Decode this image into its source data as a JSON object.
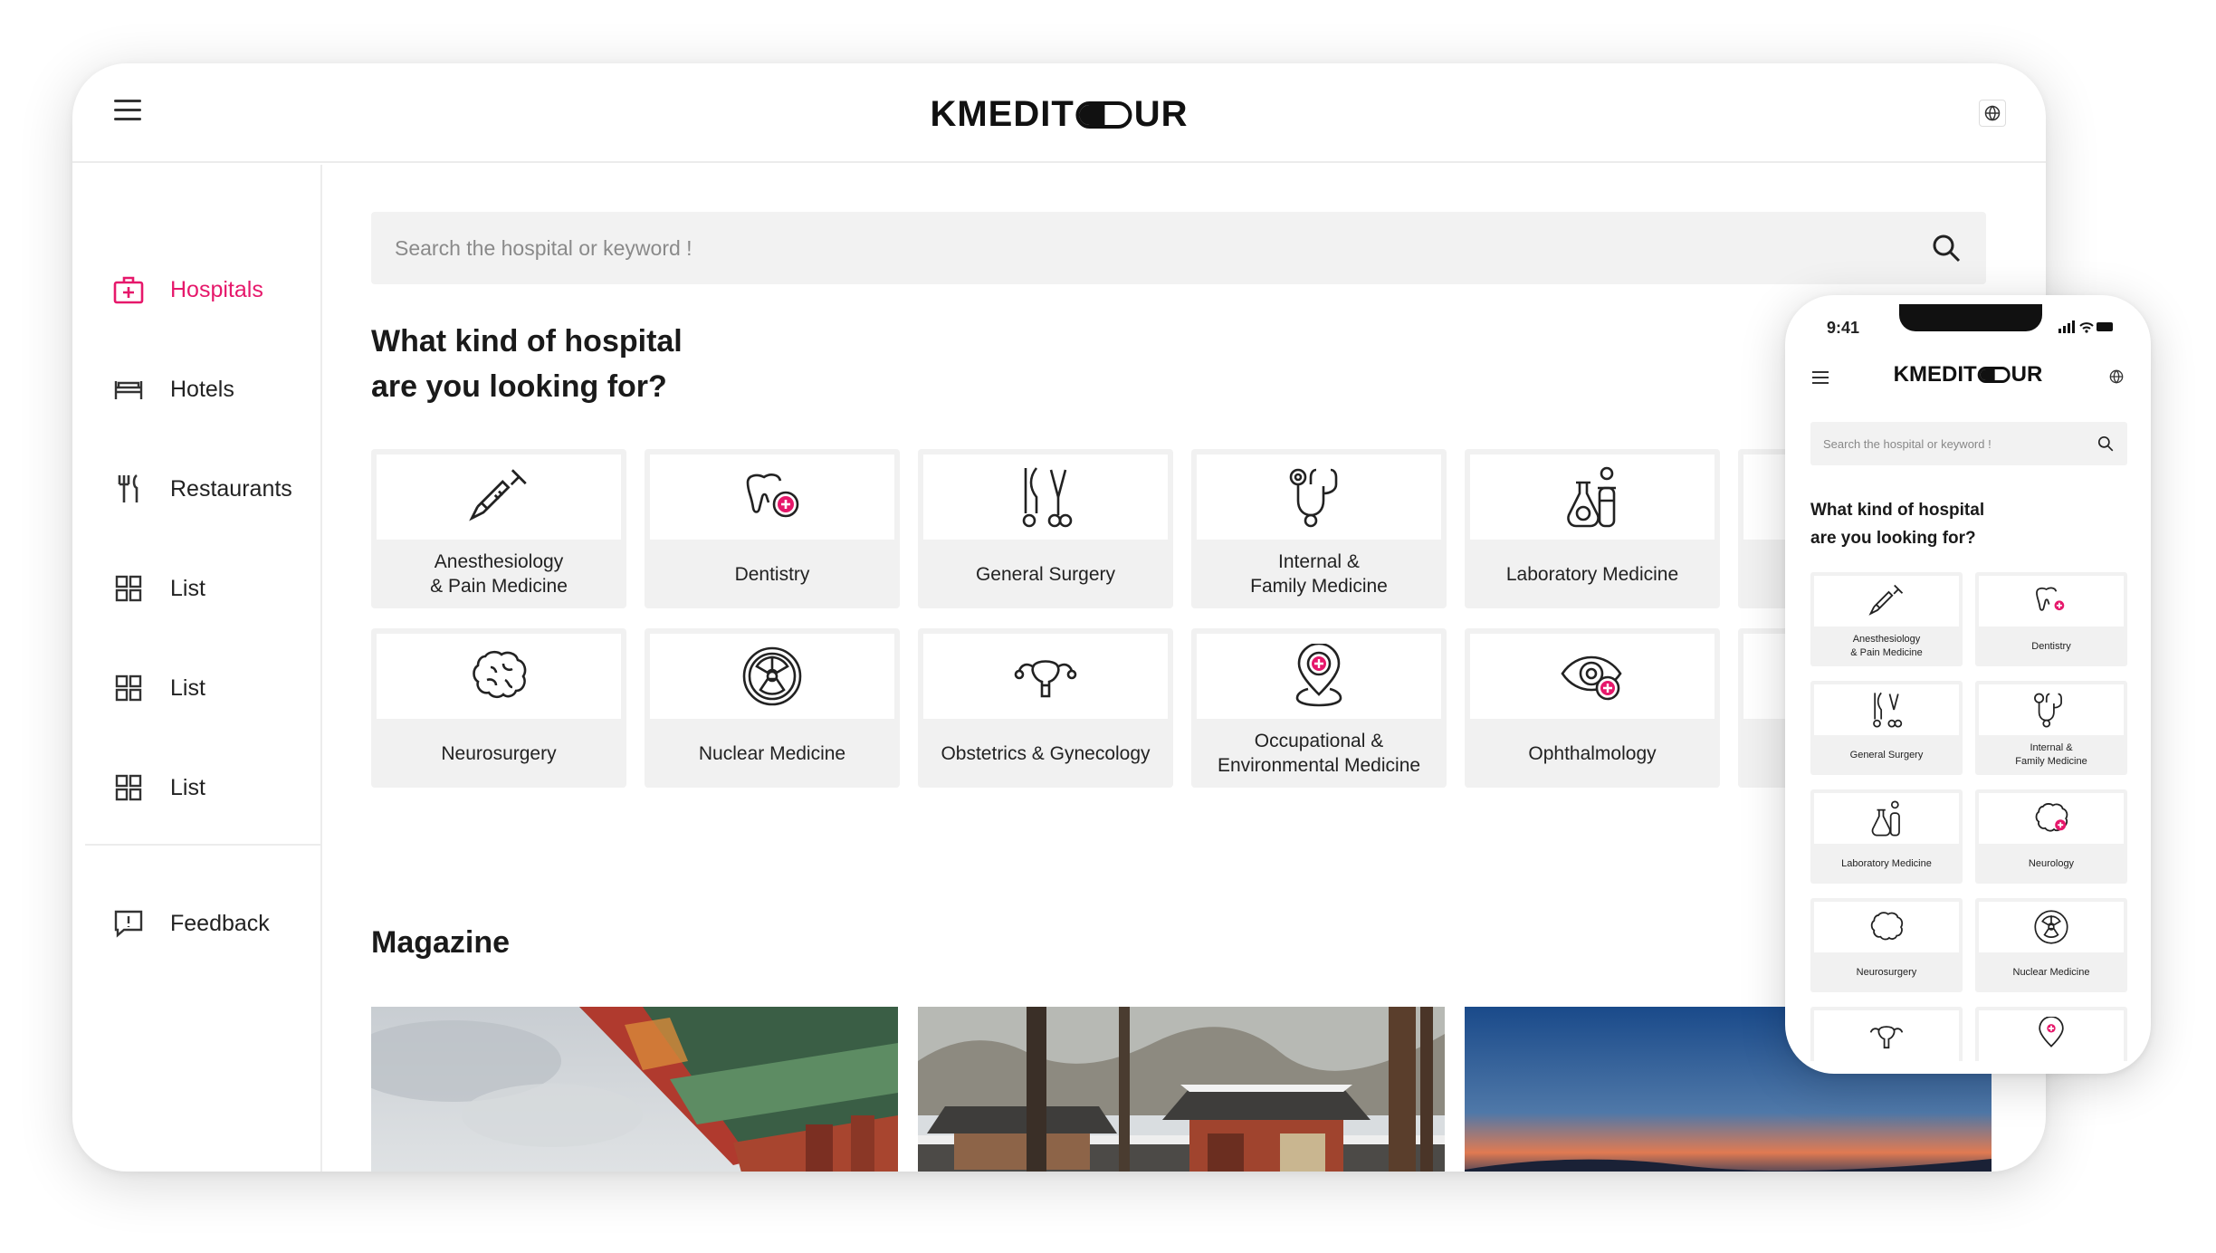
{
  "brand": {
    "logo_left": "KMEDIT",
    "logo_right": "UR",
    "accent": "#e6186b"
  },
  "sidebar": {
    "items": [
      {
        "label": "Hospitals",
        "icon": "hospital-icon",
        "active": true
      },
      {
        "label": "Hotels",
        "icon": "bed-icon",
        "active": false
      },
      {
        "label": "Restaurants",
        "icon": "fork-knife-icon",
        "active": false
      },
      {
        "label": "List",
        "icon": "grid-icon",
        "active": false
      },
      {
        "label": "List",
        "icon": "grid-icon",
        "active": false
      },
      {
        "label": "List",
        "icon": "grid-icon",
        "active": false
      }
    ],
    "feedback_label": "Feedback"
  },
  "search": {
    "placeholder": "Search the hospital or keyword !"
  },
  "main": {
    "question": "What kind of hospital\nare you looking for?",
    "categories": [
      {
        "label": "Anesthesiology\n& Pain Medicine",
        "icon": "syringe-icon"
      },
      {
        "label": "Dentistry",
        "icon": "tooth-icon"
      },
      {
        "label": "General Surgery",
        "icon": "surgery-tools-icon"
      },
      {
        "label": "Internal &\nFamily Medicine",
        "icon": "stethoscope-icon"
      },
      {
        "label": "Laboratory Medicine",
        "icon": "flask-icon"
      },
      {
        "label": "Neurosurgery",
        "icon": "brain-icon"
      },
      {
        "label": "Nuclear Medicine",
        "icon": "radiation-icon"
      },
      {
        "label": "Obstetrics & Gynecology",
        "icon": "uterus-icon"
      },
      {
        "label": "Occupational &\nEnvironmental Medicine",
        "icon": "location-plus-icon"
      },
      {
        "label": "Ophthalmology",
        "icon": "eye-icon"
      }
    ],
    "magazine_title": "Magazine"
  },
  "phone": {
    "time": "9:41",
    "search_placeholder": "Search the hospital or keyword !",
    "question": "What kind of hospital\nare you looking for?",
    "categories": [
      {
        "label": "Anesthesiology\n& Pain Medicine",
        "icon": "syringe-icon"
      },
      {
        "label": "Dentistry",
        "icon": "tooth-icon"
      },
      {
        "label": "General Surgery",
        "icon": "surgery-tools-icon"
      },
      {
        "label": "Internal &\nFamily Medicine",
        "icon": "stethoscope-icon"
      },
      {
        "label": "Laboratory Medicine",
        "icon": "flask-icon"
      },
      {
        "label": "Neurology",
        "icon": "brain-plus-icon"
      },
      {
        "label": "Neurosurgery",
        "icon": "brain-icon"
      },
      {
        "label": "Nuclear Medicine",
        "icon": "radiation-icon"
      },
      {
        "label": "",
        "icon": "uterus-icon"
      },
      {
        "label": "",
        "icon": "location-plus-icon"
      }
    ]
  }
}
